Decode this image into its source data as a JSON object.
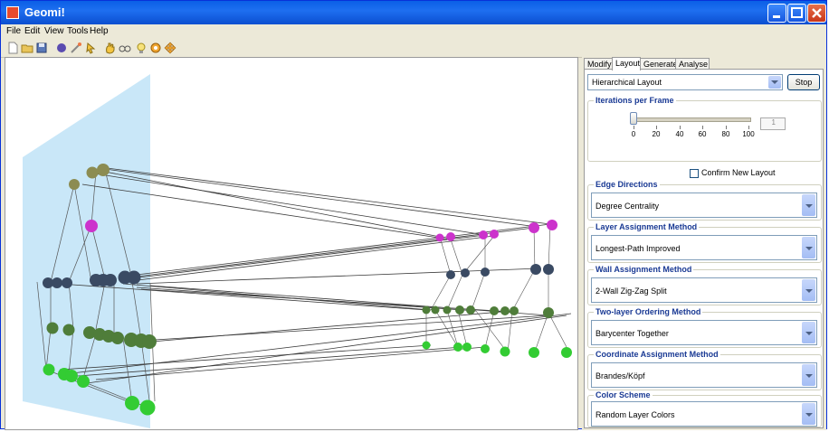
{
  "window": {
    "title": "Geomi!",
    "controls": [
      "minimize",
      "maximize",
      "close"
    ]
  },
  "menu": [
    "File",
    "Edit",
    "View",
    "Tools",
    "Help"
  ],
  "toolbar_icons": [
    "new-file-icon",
    "open-folder-icon",
    "save-icon",
    "sphere-icon",
    "wand-icon",
    "pointer-icon",
    "hand-icon",
    "glasses-icon",
    "lightbulb-icon",
    "gear-icon",
    "arrows-icon"
  ],
  "panel": {
    "tabs": [
      "Modify",
      "Layout",
      "Generate",
      "Analyse"
    ],
    "active_tab": "Layout",
    "layout_select": "Hierarchical Layout",
    "stop_button": "Stop",
    "iterations": {
      "title": "Iterations per Frame",
      "ticks": [
        "0",
        "20",
        "40",
        "60",
        "80",
        "100"
      ],
      "value": "1",
      "slider_fraction": 0.01
    },
    "confirm_label": "Confirm New Layout",
    "groups": [
      {
        "title": "Edge Directions",
        "value": "Degree Centrality"
      },
      {
        "title": "Layer Assignment Method",
        "value": "Longest-Path Improved"
      },
      {
        "title": "Wall Assignment Method",
        "value": "2-Wall Zig-Zag Split"
      },
      {
        "title": "Two-layer Ordering Method",
        "value": "Barycenter Together"
      },
      {
        "title": "Coordinate Assignment Method",
        "value": "Brandes/Köpf"
      },
      {
        "title": "Color Scheme",
        "value": "Random Layer Colors"
      }
    ]
  },
  "colors": {
    "wall": "#bfe3f7",
    "olive": "#8c8c52",
    "magenta": "#cc33cc",
    "navy": "#3a4a63",
    "darkgreen": "#4f7d3a",
    "green": "#33cc33"
  }
}
